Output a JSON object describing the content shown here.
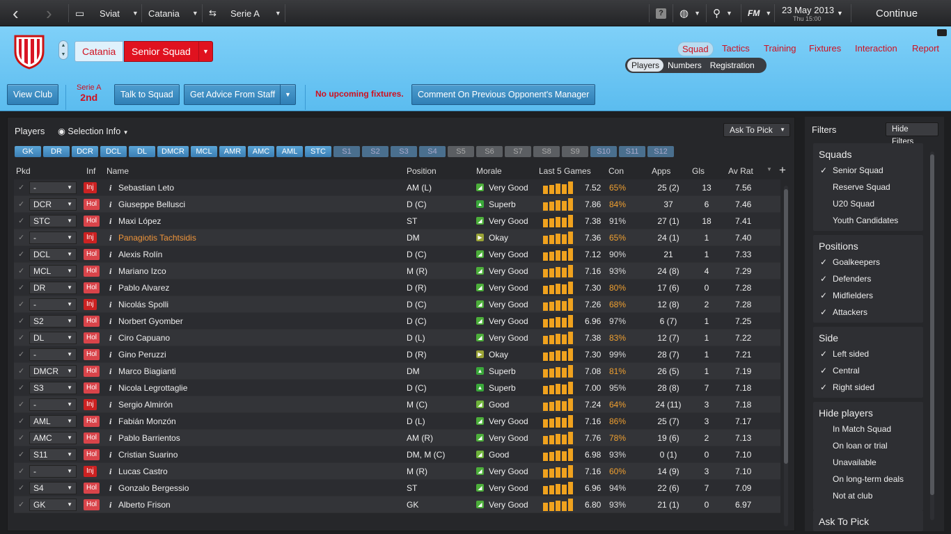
{
  "topbar": {
    "nav1": "Sviat",
    "nav2": "Catania",
    "nav3": "Serie A",
    "date": "23 May 2013",
    "time": "Thu 15:00",
    "continue": "Continue",
    "fm": "FM"
  },
  "club": {
    "name": "Catania",
    "squad": "Senior Squad"
  },
  "tabs": [
    "Squad",
    "Tactics",
    "Training",
    "Fixtures",
    "Interaction",
    "Report"
  ],
  "subtabs": [
    "Players",
    "Numbers",
    "Registration"
  ],
  "actions": {
    "view_club": "View Club",
    "league": "Serie A",
    "league_pos": "2nd",
    "talk": "Talk to Squad",
    "advice": "Get Advice From Staff",
    "no_fixtures": "No upcoming fixtures.",
    "comment": "Comment On Previous Opponent's Manager"
  },
  "panel": {
    "title": "Players",
    "view": "Selection Info",
    "ask": "Ask To Pick"
  },
  "positions": [
    "GK",
    "DR",
    "DCR",
    "DCL",
    "DL",
    "DMCR",
    "MCL",
    "AMR",
    "AMC",
    "AML",
    "STC",
    "S1",
    "S2",
    "S3",
    "S4",
    "S5",
    "S6",
    "S7",
    "S8",
    "S9",
    "S10",
    "S11",
    "S12"
  ],
  "columns": [
    "Pkd",
    "Inf",
    "Name",
    "Position",
    "Morale",
    "Last 5 Games",
    "Con",
    "Apps",
    "Gls",
    "Av Rat"
  ],
  "players": [
    {
      "pkd": "-",
      "inf": "Inj",
      "name": "Sebastian Leto",
      "pos": "AM (L)",
      "morale": "Very Good",
      "last": "7.52",
      "con": "65%",
      "apps": "25 (2)",
      "gls": "13",
      "rat": "7.56"
    },
    {
      "pkd": "DCR",
      "inf": "Hol",
      "name": "Giuseppe Bellusci",
      "pos": "D (C)",
      "morale": "Superb",
      "last": "7.86",
      "con": "84%",
      "apps": "37",
      "gls": "6",
      "rat": "7.46"
    },
    {
      "pkd": "STC",
      "inf": "Hol",
      "name": "Maxi López",
      "pos": "ST",
      "morale": "Very Good",
      "last": "7.38",
      "con": "91%",
      "apps": "27 (1)",
      "gls": "18",
      "rat": "7.41"
    },
    {
      "pkd": "-",
      "inf": "Inj",
      "name": "Panagiotis Tachtsidis",
      "pos": "DM",
      "morale": "Okay",
      "last": "7.36",
      "con": "65%",
      "apps": "24 (1)",
      "gls": "1",
      "rat": "7.40"
    },
    {
      "pkd": "DCL",
      "inf": "Hol",
      "name": "Alexis Rolín",
      "pos": "D (C)",
      "morale": "Very Good",
      "last": "7.12",
      "con": "90%",
      "apps": "21",
      "gls": "1",
      "rat": "7.33"
    },
    {
      "pkd": "MCL",
      "inf": "Hol",
      "name": "Mariano Izco",
      "pos": "M (R)",
      "morale": "Very Good",
      "last": "7.16",
      "con": "93%",
      "apps": "24 (8)",
      "gls": "4",
      "rat": "7.29"
    },
    {
      "pkd": "DR",
      "inf": "Hol",
      "name": "Pablo Alvarez",
      "pos": "D (R)",
      "morale": "Very Good",
      "last": "7.30",
      "con": "80%",
      "apps": "17 (6)",
      "gls": "0",
      "rat": "7.28"
    },
    {
      "pkd": "-",
      "inf": "Inj",
      "name": "Nicolás Spolli",
      "pos": "D (C)",
      "morale": "Very Good",
      "last": "7.26",
      "con": "68%",
      "apps": "12 (8)",
      "gls": "2",
      "rat": "7.28"
    },
    {
      "pkd": "S2",
      "inf": "Hol",
      "name": "Norbert Gyomber",
      "pos": "D (C)",
      "morale": "Very Good",
      "last": "6.96",
      "con": "97%",
      "apps": "6 (7)",
      "gls": "1",
      "rat": "7.25"
    },
    {
      "pkd": "DL",
      "inf": "Hol",
      "name": "Ciro Capuano",
      "pos": "D (L)",
      "morale": "Very Good",
      "last": "7.38",
      "con": "83%",
      "apps": "12 (7)",
      "gls": "1",
      "rat": "7.22"
    },
    {
      "pkd": "-",
      "inf": "Hol",
      "name": "Gino Peruzzi",
      "pos": "D (R)",
      "morale": "Okay",
      "last": "7.30",
      "con": "99%",
      "apps": "28 (7)",
      "gls": "1",
      "rat": "7.21"
    },
    {
      "pkd": "DMCR",
      "inf": "Hol",
      "name": "Marco Biagianti",
      "pos": "DM",
      "morale": "Superb",
      "last": "7.08",
      "con": "81%",
      "apps": "26 (5)",
      "gls": "1",
      "rat": "7.19"
    },
    {
      "pkd": "S3",
      "inf": "Hol",
      "name": "Nicola Legrottaglie",
      "pos": "D (C)",
      "morale": "Superb",
      "last": "7.00",
      "con": "95%",
      "apps": "28 (8)",
      "gls": "7",
      "rat": "7.18"
    },
    {
      "pkd": "-",
      "inf": "Inj",
      "name": "Sergio Almirón",
      "pos": "M (C)",
      "morale": "Good",
      "last": "7.24",
      "con": "64%",
      "apps": "24 (11)",
      "gls": "3",
      "rat": "7.18"
    },
    {
      "pkd": "AML",
      "inf": "Hol",
      "name": "Fabián Monzón",
      "pos": "D (L)",
      "morale": "Very Good",
      "last": "7.16",
      "con": "86%",
      "apps": "25 (7)",
      "gls": "3",
      "rat": "7.17"
    },
    {
      "pkd": "AMC",
      "inf": "Hol",
      "name": "Pablo Barrientos",
      "pos": "AM (R)",
      "morale": "Very Good",
      "last": "7.76",
      "con": "78%",
      "apps": "19 (6)",
      "gls": "2",
      "rat": "7.13"
    },
    {
      "pkd": "S11",
      "inf": "Hol",
      "name": "Cristian Suarino",
      "pos": "DM, M (C)",
      "morale": "Good",
      "last": "6.98",
      "con": "93%",
      "apps": "0 (1)",
      "gls": "0",
      "rat": "7.10"
    },
    {
      "pkd": "-",
      "inf": "Inj",
      "name": "Lucas Castro",
      "pos": "M (R)",
      "morale": "Very Good",
      "last": "7.16",
      "con": "60%",
      "apps": "14 (9)",
      "gls": "3",
      "rat": "7.10"
    },
    {
      "pkd": "S4",
      "inf": "Hol",
      "name": "Gonzalo Bergessio",
      "pos": "ST",
      "morale": "Very Good",
      "last": "6.96",
      "con": "94%",
      "apps": "22 (6)",
      "gls": "7",
      "rat": "7.09"
    },
    {
      "pkd": "GK",
      "inf": "Hol",
      "name": "Alberto Frison",
      "pos": "GK",
      "morale": "Very Good",
      "last": "6.80",
      "con": "93%",
      "apps": "21 (1)",
      "gls": "0",
      "rat": "6.97"
    }
  ],
  "filters": {
    "title": "Filters",
    "hide": "Hide Filters",
    "groups": [
      {
        "title": "Squads",
        "items": [
          {
            "label": "Senior Squad",
            "checked": true
          },
          {
            "label": "Reserve Squad",
            "checked": false
          },
          {
            "label": "U20 Squad",
            "checked": false
          },
          {
            "label": "Youth Candidates",
            "checked": false
          }
        ]
      },
      {
        "title": "Positions",
        "items": [
          {
            "label": "Goalkeepers",
            "checked": true
          },
          {
            "label": "Defenders",
            "checked": true
          },
          {
            "label": "Midfielders",
            "checked": true
          },
          {
            "label": "Attackers",
            "checked": true
          }
        ]
      },
      {
        "title": "Side",
        "items": [
          {
            "label": "Left sided",
            "checked": true
          },
          {
            "label": "Central",
            "checked": true
          },
          {
            "label": "Right sided",
            "checked": true
          }
        ]
      },
      {
        "title": "Hide players",
        "items": [
          {
            "label": "In Match Squad",
            "checked": false
          },
          {
            "label": "On loan or trial",
            "checked": false
          },
          {
            "label": "Unavailable",
            "checked": false
          },
          {
            "label": "On long-term deals",
            "checked": false
          },
          {
            "label": "Not at club",
            "checked": false
          }
        ]
      }
    ],
    "ask_to_pick": "Ask To Pick"
  },
  "colors": {
    "accent_blue": "#5bbcef",
    "red": "#e0121f",
    "bar": "#f0a21e"
  }
}
